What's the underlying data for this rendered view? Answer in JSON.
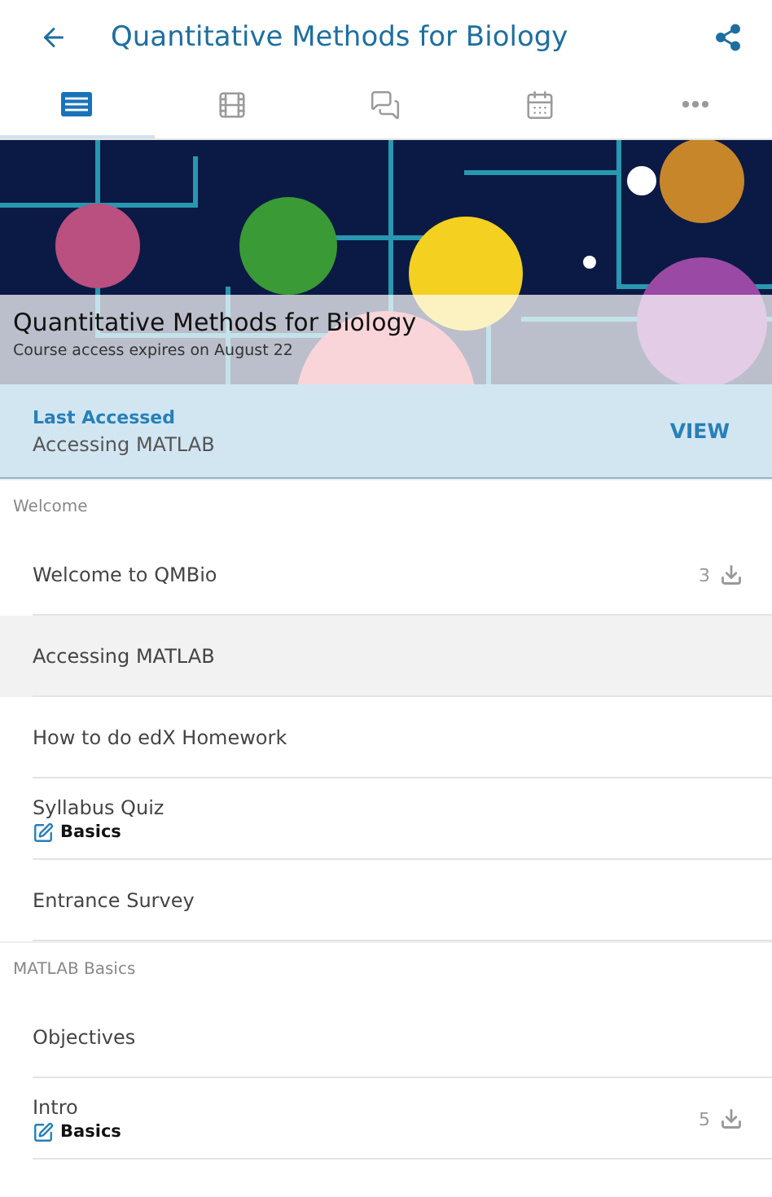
{
  "header": {
    "title": "Quantitative Methods for Biology"
  },
  "tabs": [
    {
      "kind": "outline",
      "selected": true
    },
    {
      "kind": "videos",
      "selected": false
    },
    {
      "kind": "discussion",
      "selected": false
    },
    {
      "kind": "dates",
      "selected": false
    },
    {
      "kind": "more",
      "selected": false
    }
  ],
  "banner": {
    "title": "Quantitative Methods for Biology",
    "subtitle": "Course access expires on August 22"
  },
  "last_accessed": {
    "label": "Last Accessed",
    "item": "Accessing MATLAB",
    "action": "VIEW"
  },
  "sections": [
    {
      "title": "Welcome",
      "items": [
        {
          "title": "Welcome to QMBio",
          "selected": false,
          "downloads": "3"
        },
        {
          "title": "Accessing MATLAB",
          "selected": true
        },
        {
          "title": "How to do edX Homework",
          "selected": false
        },
        {
          "title": "Syllabus Quiz",
          "selected": false,
          "graded": "Basics"
        },
        {
          "title": "Entrance Survey",
          "selected": false
        }
      ]
    },
    {
      "title": "MATLAB Basics",
      "items": [
        {
          "title": "Objectives",
          "selected": false
        },
        {
          "title": "Intro",
          "selected": false,
          "graded": "Basics",
          "downloads": "5"
        }
      ]
    }
  ]
}
